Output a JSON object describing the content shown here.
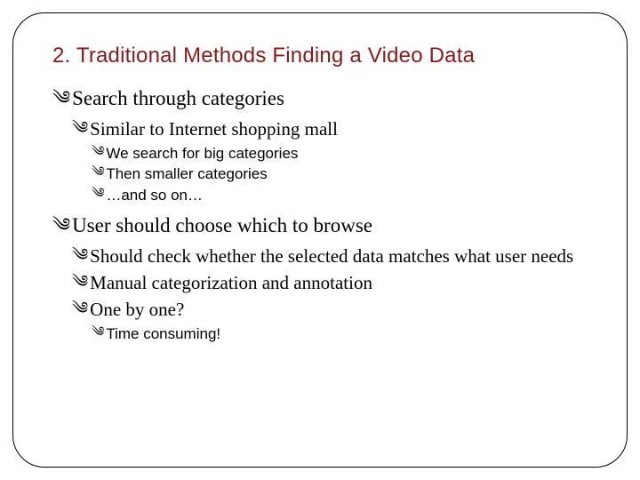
{
  "title": "2. Traditional Methods Finding a Video Data",
  "bullet_glyph": "༄",
  "items": {
    "l1a": "Search through categories",
    "l2a": "Similar to Internet shopping mall",
    "l3a": "We search for big categories",
    "l3b": "Then smaller categories",
    "l3c": "…and so on…",
    "l1b": "User should choose which to browse",
    "l2b": "Should check whether the selected data matches what user needs",
    "l2c": "Manual categorization and annotation",
    "l2d": "One by one?",
    "l3d": "Time consuming!"
  }
}
